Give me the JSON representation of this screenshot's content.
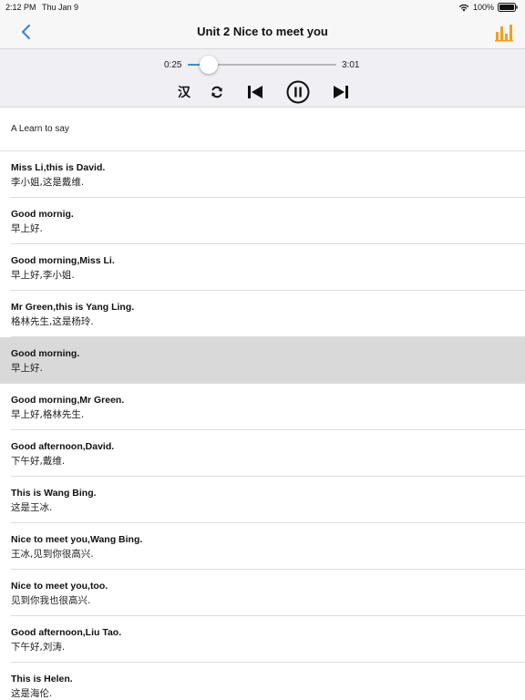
{
  "status_bar": {
    "time": "2:12 PM",
    "date": "Thu Jan 9",
    "battery": "100%"
  },
  "nav": {
    "title": "Unit 2  Nice to meet you",
    "accent_color": "#3a8ad8",
    "stats_color": "#f0a020"
  },
  "player": {
    "current_time": "0:25",
    "total_time": "3:01",
    "progress": 0.14,
    "han_label": "汉"
  },
  "list": {
    "section_title": "A Learn to say",
    "selected_index": 4,
    "items": [
      {
        "en": "Miss Li,this is David.",
        "zh": "李小姐,这是戴维."
      },
      {
        "en": "Good mornig.",
        "zh": "早上好."
      },
      {
        "en": "Good morning,Miss Li.",
        "zh": "早上好,李小姐."
      },
      {
        "en": "Mr Green,this is Yang Ling.",
        "zh": "格林先生,这是杨玲."
      },
      {
        "en": "Good morning.",
        "zh": "早上好."
      },
      {
        "en": "Good morning,Mr Green.",
        "zh": "早上好,格林先生."
      },
      {
        "en": "Good afternoon,David.",
        "zh": "下午好,戴维."
      },
      {
        "en": "This is Wang Bing.",
        "zh": "这是王冰."
      },
      {
        "en": "Nice to meet you,Wang Bing.",
        "zh": "王冰,见到你很高兴."
      },
      {
        "en": "Nice to meet you,too.",
        "zh": "见到你我也很高兴."
      },
      {
        "en": "Good afternoon,Liu Tao.",
        "zh": "下午好,刘涛."
      },
      {
        "en": "This is Helen.",
        "zh": "这是海伦."
      }
    ]
  }
}
